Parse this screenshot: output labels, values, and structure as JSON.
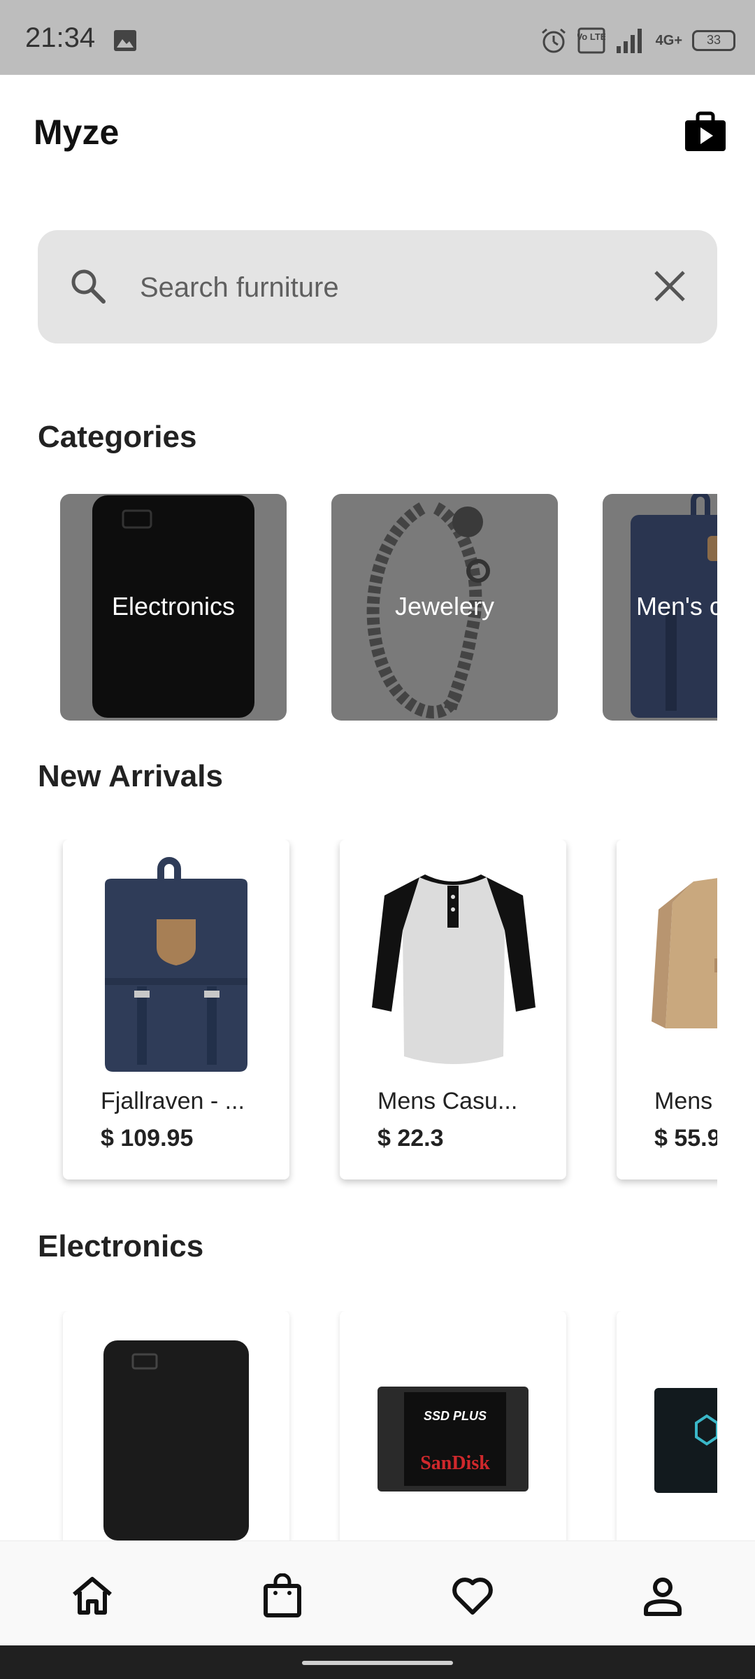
{
  "status_bar": {
    "time": "21:34",
    "network": "4G+",
    "volte": "Vo LTE",
    "battery": "33",
    "icons": [
      "image-icon",
      "alarm-icon",
      "volte-icon",
      "signal-icon",
      "network-icon",
      "battery-icon"
    ]
  },
  "app_bar": {
    "title": "Myze",
    "action_icon": "shopping-bag-play-icon"
  },
  "search": {
    "placeholder": "Search furniture",
    "value": "",
    "icon": "search-icon",
    "clear_icon": "close-icon"
  },
  "sections": {
    "categories": {
      "title": "Categories",
      "items": [
        {
          "label": "Electronics"
        },
        {
          "label": "Jewelery"
        },
        {
          "label": "Men's c"
        }
      ]
    },
    "new_arrivals": {
      "title": "New Arrivals",
      "items": [
        {
          "name": "Fjallraven - ...",
          "price": "$ 109.95"
        },
        {
          "name": "Mens Casu...",
          "price": "$ 22.3"
        },
        {
          "name": "Mens",
          "price": "$ 55.9"
        }
      ]
    },
    "electronics": {
      "title": "Electronics",
      "items": [
        {
          "image": "external-hard-drive"
        },
        {
          "image": "ssd-drive"
        },
        {
          "image": "ssd-drive-2"
        }
      ]
    }
  },
  "bottom_nav": {
    "items": [
      {
        "name": "home",
        "icon": "home-icon"
      },
      {
        "name": "bag",
        "icon": "shopping-bag-icon"
      },
      {
        "name": "favorites",
        "icon": "heart-icon"
      },
      {
        "name": "profile",
        "icon": "user-icon"
      }
    ]
  },
  "colors": {
    "status_bar_bg": "#bdbdbd",
    "search_bg": "#e4e4e4",
    "category_overlay": "#7a7a7a",
    "backpack_navy": "#2f3c58",
    "text_dark": "#1f1f1f"
  }
}
